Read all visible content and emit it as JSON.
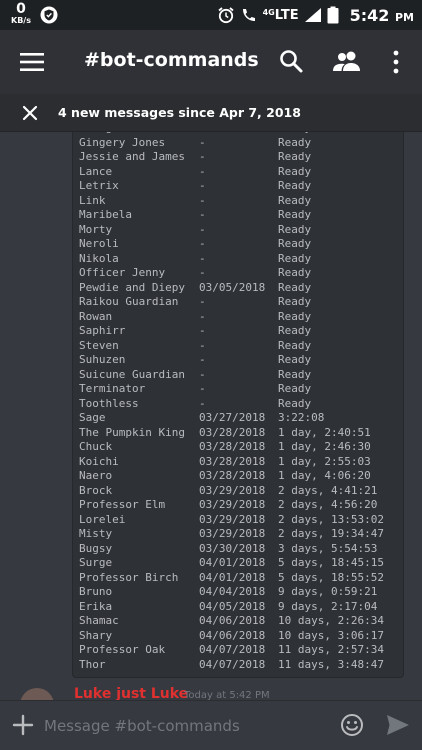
{
  "status_bar": {
    "net_speed": "0",
    "net_unit": "KB/s",
    "network": "LTE",
    "network_sub": "4G",
    "time": "5:42",
    "time_suffix": "PM"
  },
  "header": {
    "channel_title": "#bot-commands",
    "icons": [
      "menu-icon",
      "search-icon",
      "members-icon",
      "more-vertical-icon"
    ]
  },
  "new_messages_banner": {
    "text": "4 new messages since Apr 7, 2018"
  },
  "code_block": {
    "rows": [
      {
        "name": "George",
        "date": "-",
        "status": "Ready"
      },
      {
        "name": "Gingery Jones",
        "date": "-",
        "status": "Ready"
      },
      {
        "name": "Jessie and James",
        "date": "-",
        "status": "Ready"
      },
      {
        "name": "Lance",
        "date": "-",
        "status": "Ready"
      },
      {
        "name": "Letrix",
        "date": "-",
        "status": "Ready"
      },
      {
        "name": "Link",
        "date": "-",
        "status": "Ready"
      },
      {
        "name": "Maribela",
        "date": "-",
        "status": "Ready"
      },
      {
        "name": "Morty",
        "date": "-",
        "status": "Ready"
      },
      {
        "name": "Neroli",
        "date": "-",
        "status": "Ready"
      },
      {
        "name": "Nikola",
        "date": "-",
        "status": "Ready"
      },
      {
        "name": "Officer Jenny",
        "date": "-",
        "status": "Ready"
      },
      {
        "name": "Pewdie and Diepy",
        "date": "03/05/2018",
        "status": "Ready"
      },
      {
        "name": "Raikou Guardian",
        "date": "-",
        "status": "Ready"
      },
      {
        "name": "Rowan",
        "date": "-",
        "status": "Ready"
      },
      {
        "name": "Saphirr",
        "date": "-",
        "status": "Ready"
      },
      {
        "name": "Steven",
        "date": "-",
        "status": "Ready"
      },
      {
        "name": "Suhuzen",
        "date": "-",
        "status": "Ready"
      },
      {
        "name": "Suicune Guardian",
        "date": "-",
        "status": "Ready"
      },
      {
        "name": "Terminator",
        "date": "-",
        "status": "Ready"
      },
      {
        "name": "Toothless",
        "date": "-",
        "status": "Ready"
      },
      {
        "name": "Sage",
        "date": "03/27/2018",
        "status": "3:22:08"
      },
      {
        "name": "The Pumpkin King",
        "date": "03/28/2018",
        "status": "1 day, 2:40:51"
      },
      {
        "name": "Chuck",
        "date": "03/28/2018",
        "status": "1 day, 2:46:30"
      },
      {
        "name": "Koichi",
        "date": "03/28/2018",
        "status": "1 day, 2:55:03"
      },
      {
        "name": "Naero",
        "date": "03/28/2018",
        "status": "1 day, 4:06:20"
      },
      {
        "name": "Brock",
        "date": "03/29/2018",
        "status": "2 days, 4:41:21"
      },
      {
        "name": "Professor Elm",
        "date": "03/29/2018",
        "status": "2 days, 4:56:20"
      },
      {
        "name": "Lorelei",
        "date": "03/29/2018",
        "status": "2 days, 13:53:02"
      },
      {
        "name": "Misty",
        "date": "03/29/2018",
        "status": "2 days, 19:34:47"
      },
      {
        "name": "Bugsy",
        "date": "03/30/2018",
        "status": "3 days, 5:54:53"
      },
      {
        "name": "Surge",
        "date": "04/01/2018",
        "status": "5 days, 18:45:15"
      },
      {
        "name": "Professor Birch",
        "date": "04/01/2018",
        "status": "5 days, 18:55:52"
      },
      {
        "name": "Bruno",
        "date": "04/04/2018",
        "status": "9 days, 0:59:21"
      },
      {
        "name": "Erika",
        "date": "04/05/2018",
        "status": "9 days, 2:17:04"
      },
      {
        "name": "Shamac",
        "date": "04/06/2018",
        "status": "10 days, 2:26:34"
      },
      {
        "name": "Shary",
        "date": "04/06/2018",
        "status": "10 days, 3:06:17"
      },
      {
        "name": "Professor Oak",
        "date": "04/07/2018",
        "status": "11 days, 2:57:34"
      },
      {
        "name": "Thor",
        "date": "04/07/2018",
        "status": "11 days, 3:48:47"
      }
    ]
  },
  "next_message": {
    "author": "Luke just Luke",
    "timestamp": "Today at 5:42 PM"
  },
  "composer": {
    "placeholder": "Message #bot-commands"
  },
  "colors": {
    "background": "#36393f",
    "header": "#2f3136",
    "codeblock": "#2e3136",
    "author_red": "#e0302f"
  }
}
